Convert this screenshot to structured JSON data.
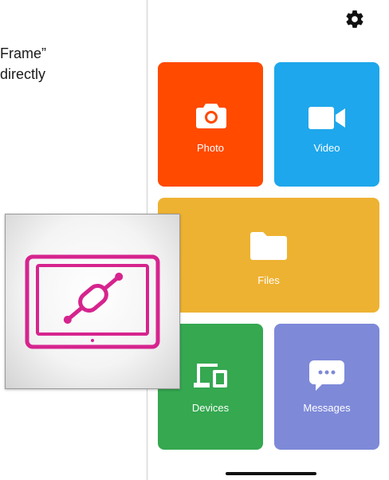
{
  "background_text": {
    "line1": "Frame”",
    "line2": "directly"
  },
  "header": {
    "settings_icon": "gear-icon"
  },
  "tiles": [
    {
      "label": "Photo",
      "icon": "camera-icon",
      "color": "#ff4a00"
    },
    {
      "label": "Video",
      "icon": "video-camera-icon",
      "color": "#1ea7ec"
    },
    {
      "label": "Files",
      "icon": "folder-icon",
      "color": "#eeb232"
    },
    {
      "label": "Devices",
      "icon": "devices-icon",
      "color": "#35a850"
    },
    {
      "label": "Messages",
      "icon": "message-bubble-icon",
      "color": "#7e89d8"
    }
  ],
  "app_icon": {
    "name": "frame-connect-app-icon",
    "accent": "#d6248e"
  }
}
